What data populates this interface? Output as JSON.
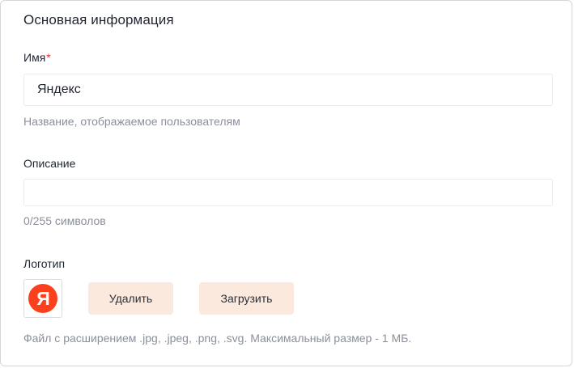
{
  "section": {
    "title": "Основная информация"
  },
  "name_field": {
    "label": "Имя",
    "required_mark": "*",
    "value": "Яндекс",
    "hint": "Название, отображаемое пользователям"
  },
  "description_field": {
    "label": "Описание",
    "value": "",
    "counter": "0/255 символов"
  },
  "logo_field": {
    "label": "Логотип",
    "logo_letter": "Я",
    "logo_color": "#fc3f1d",
    "delete_label": "Удалить",
    "upload_label": "Загрузить",
    "hint": "Файл с расширением .jpg, .jpeg, .png, .svg. Максимальный размер - 1 МБ."
  },
  "colors": {
    "button_bg": "#fbe9dd",
    "required": "#e0303a",
    "hint_text": "#8a8f99"
  }
}
